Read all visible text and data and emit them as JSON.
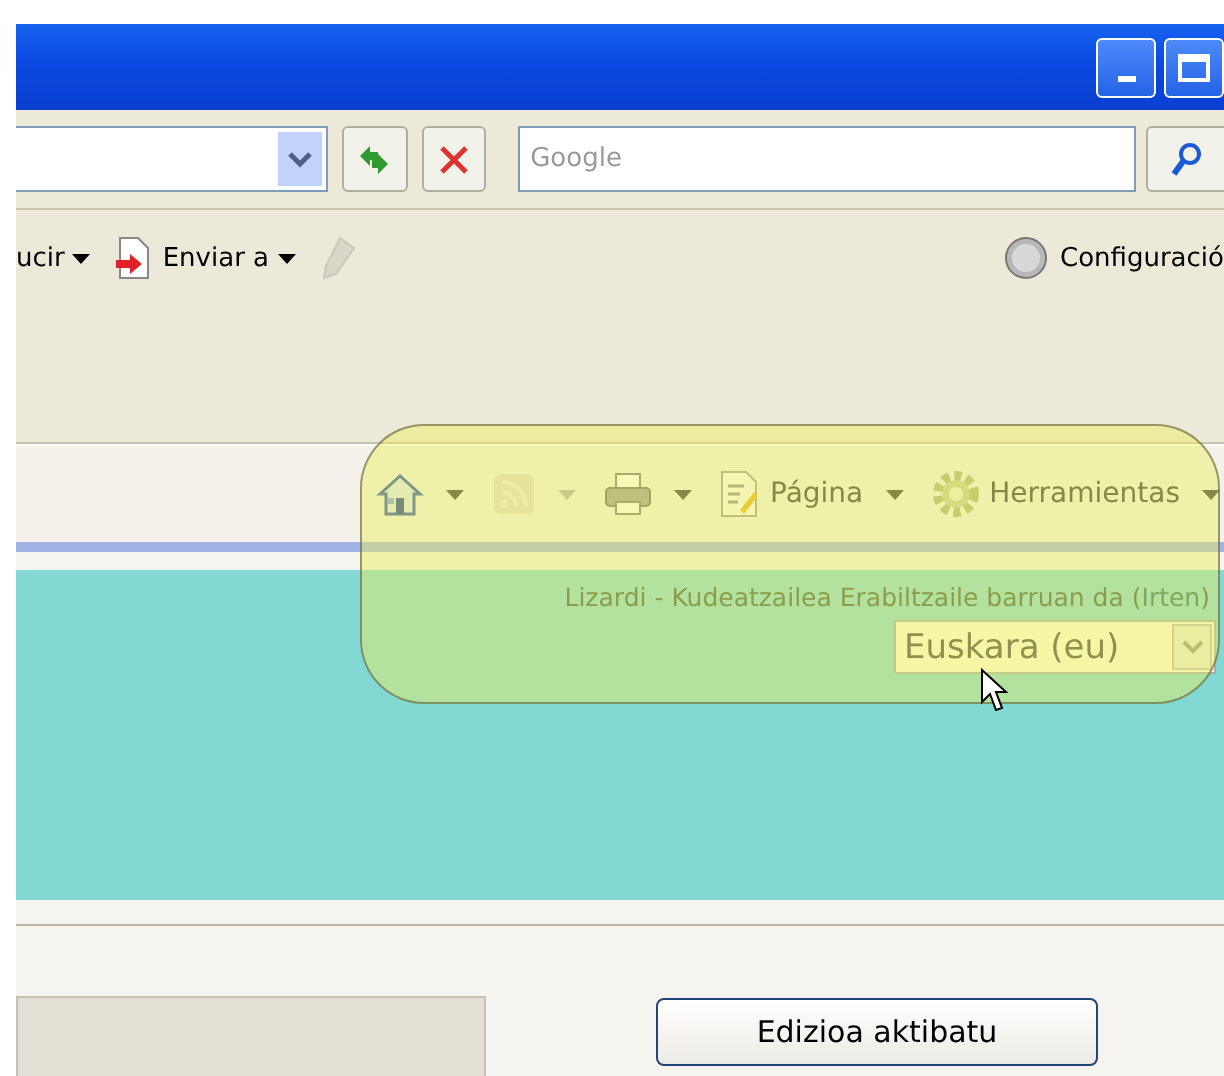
{
  "window": {
    "controls": [
      {
        "kind": "minimize"
      },
      {
        "kind": "maximize"
      }
    ]
  },
  "address_bar": {
    "search": {
      "placeholder": "Google"
    }
  },
  "links_bar": {
    "items": [
      {
        "kind": "menu",
        "label": "ucir",
        "disabled": false
      },
      {
        "kind": "send",
        "label": "Enviar a",
        "disabled": false
      },
      {
        "kind": "brush",
        "disabled": true
      }
    ],
    "settings": {
      "label": "Configuració"
    }
  },
  "command_bar": [
    {
      "kind": "home",
      "disabled": false
    },
    {
      "kind": "feeds",
      "disabled": true
    },
    {
      "kind": "print",
      "disabled": false
    },
    {
      "kind": "page",
      "label": "Página",
      "disabled": false
    },
    {
      "kind": "tools",
      "label": "Herramientas",
      "disabled": false
    }
  ],
  "page": {
    "login_line": {
      "before": "Lizardi - Kudeatzailea Erabiltzaile barruan da (",
      "link": "Irten",
      "after": ")"
    },
    "language": {
      "value": "Euskara (eu)"
    },
    "edit_button": "Edizioa aktibatu"
  },
  "highlight": {
    "shown": true
  }
}
